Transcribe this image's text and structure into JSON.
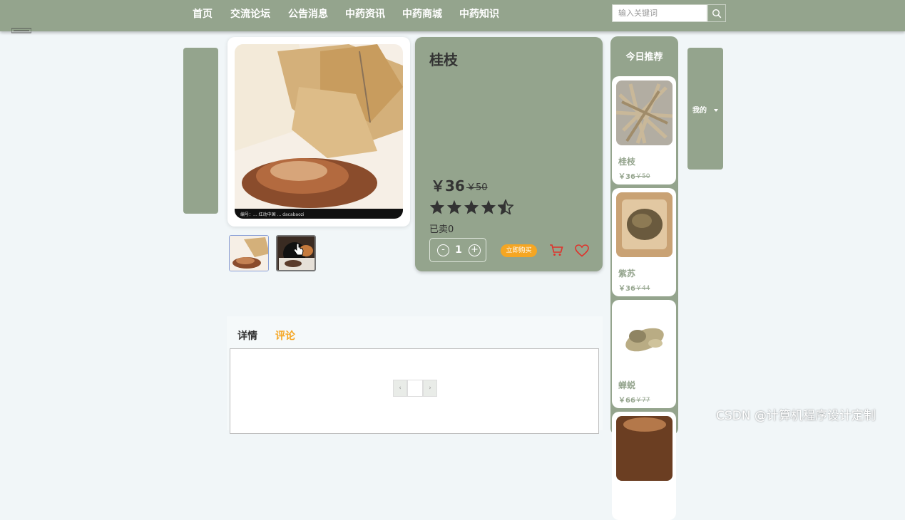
{
  "nav": {
    "items": [
      {
        "label": "首页"
      },
      {
        "label": "交流论坛"
      },
      {
        "label": "公告消息"
      },
      {
        "label": "中药资讯"
      },
      {
        "label": "中药商城"
      },
      {
        "label": "中药知识"
      }
    ],
    "search_placeholder": "输入关键词"
  },
  "product": {
    "title": "桂枝",
    "price": "￥36",
    "old_price": "￥50",
    "rating": 4.5,
    "sold": "已卖0",
    "quantity": "1",
    "buy_label": "立即购买",
    "qty_minus": "-",
    "qty_plus": "+",
    "image_caption": "编号：..."
  },
  "tabs": [
    {
      "label": "详情"
    },
    {
      "label": "评论"
    }
  ],
  "pager": {
    "prev": "‹",
    "next": "›"
  },
  "recommend": {
    "title": "今日推荐",
    "items": [
      {
        "name": "桂枝",
        "price": "￥36",
        "old_price": "￥50"
      },
      {
        "name": "紫苏",
        "price": "￥36",
        "old_price": "￥44"
      },
      {
        "name": "蝉蜕",
        "price": "￥66",
        "old_price": "￥77"
      }
    ]
  },
  "right_menu": {
    "label": "我的"
  },
  "watermark": "CSDN @计算机程序设计定制",
  "colors": {
    "accent": "#94a48d",
    "background": "#f1f6f8",
    "buy": "#f5a623",
    "active_tab": "#f5a623",
    "icon_red": "#e0322b"
  }
}
